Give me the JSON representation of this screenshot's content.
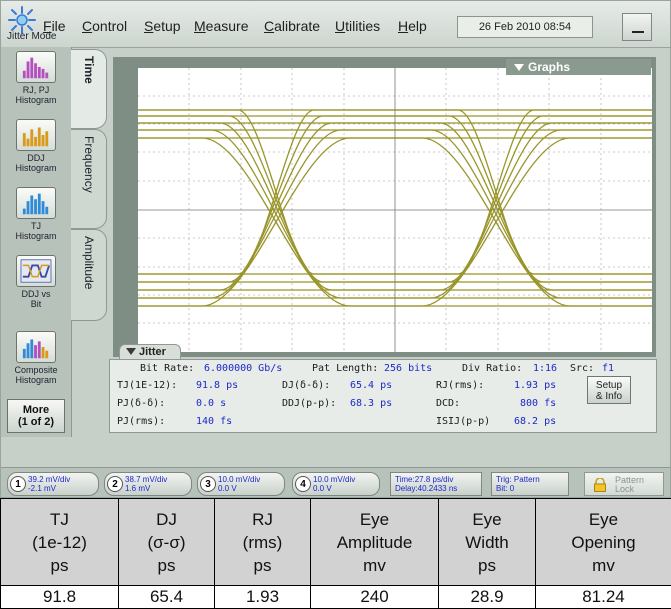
{
  "app": {
    "mode": "Jitter Mode",
    "datetime": "26 Feb 2010  08:54"
  },
  "menu": [
    "File",
    "Control",
    "Setup",
    "Measure",
    "Calibrate",
    "Utilities",
    "Help"
  ],
  "tools": [
    {
      "label": "RJ, PJ\nHistogram",
      "icon": "rj-pj-histogram-icon"
    },
    {
      "label": "DDJ\nHistogram",
      "icon": "ddj-histogram-icon"
    },
    {
      "label": "TJ\nHistogram",
      "icon": "tj-histogram-icon"
    },
    {
      "label": "DDJ vs\nBit",
      "icon": "ddj-vs-bit-icon"
    },
    {
      "label": "Composite\nHistogram",
      "icon": "composite-histogram-icon"
    }
  ],
  "more_button": "More\n(1 of 2)",
  "tabs": [
    "Time",
    "Frequency",
    "Amplitude"
  ],
  "graphs_label": "Graphs",
  "jitter": {
    "tab_label": "Jitter",
    "bit_rate_label": "Bit Rate:",
    "bit_rate": "6.000000 Gb/s",
    "pat_length_label": "Pat Length:",
    "pat_length": "256 bits",
    "div_ratio_label": "Div Ratio:",
    "div_ratio": "1:16",
    "src_label": "Src:",
    "src": "f1",
    "tj_label": "TJ(1E-12):",
    "tj": "91.8 ps",
    "dj_label": "DJ(δ-δ):",
    "dj": "65.4 ps",
    "rj_label": "RJ(rms):",
    "rj": "1.93 ps",
    "pj_label": "PJ(δ-δ):",
    "pj": "0.0 s",
    "ddj_label": "DDJ(p-p):",
    "ddj": "68.3 ps",
    "dcd_label": "DCD:",
    "dcd": "800 fs",
    "pjrms_label": "PJ(rms):",
    "pjrms": "140 fs",
    "isi_label": "ISIJ(p-p)",
    "isi": "68.2 ps",
    "setup_button": "Setup\n& Info"
  },
  "channels": [
    {
      "num": "1",
      "scale": "39.2 mV/div",
      "offset": "-2.1 mV"
    },
    {
      "num": "2",
      "scale": "38.7 mV/div",
      "offset": "1.6 mV"
    },
    {
      "num": "3",
      "scale": "10.0 mV/div",
      "offset": "0.0 V"
    },
    {
      "num": "4",
      "scale": "10.0 mV/div",
      "offset": "0.0 V"
    }
  ],
  "timebase": {
    "time": "Time:27.8 ps/div",
    "delay": "Delay:40.2433 ns"
  },
  "trigger": {
    "trig": "Trig: Pattern",
    "bit": "Bit: 0"
  },
  "pattern_lock": "Pattern\nLock",
  "results": {
    "headers": [
      "TJ\n(1e-12)\nps",
      "DJ\n(σ-σ)\nps",
      "RJ\n(rms)\nps",
      "Eye\nAmplitude\nmv",
      "Eye\nWidth\nps",
      "Eye\nOpening\nmv"
    ],
    "values": [
      "91.8",
      "65.4",
      "1.93",
      "240",
      "28.9",
      "81.24"
    ]
  },
  "colors": {
    "trace": "#8f8a14",
    "panel": "#c6cfc8",
    "value_text": "#1b28c8"
  }
}
